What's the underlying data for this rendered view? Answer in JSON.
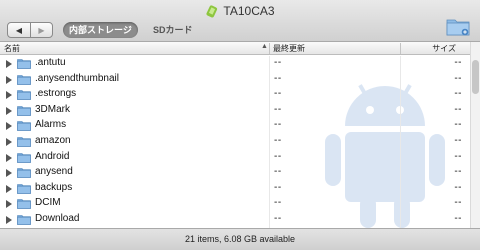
{
  "window": {
    "title": "TA10CA3",
    "nav": {
      "back_glyph": "◀",
      "forward_glyph": "▶"
    },
    "storage_tabs": [
      {
        "label": "内部ストレージ",
        "active": true
      },
      {
        "label": "SDカード",
        "active": false
      }
    ],
    "icons": {
      "title": "android-device-icon",
      "new_folder": "new-folder-icon",
      "watermark": "android-robot-watermark"
    }
  },
  "columns": {
    "name": "名前",
    "date": "最終更新",
    "size": "サイズ"
  },
  "files": [
    {
      "name": ".antutu",
      "date": "--",
      "size": "--"
    },
    {
      "name": ".anysendthumbnail",
      "date": "--",
      "size": "--"
    },
    {
      "name": ".estrongs",
      "date": "--",
      "size": "--"
    },
    {
      "name": "3DMark",
      "date": "--",
      "size": "--"
    },
    {
      "name": "Alarms",
      "date": "--",
      "size": "--"
    },
    {
      "name": "amazon",
      "date": "--",
      "size": "--"
    },
    {
      "name": "Android",
      "date": "--",
      "size": "--"
    },
    {
      "name": "anysend",
      "date": "--",
      "size": "--"
    },
    {
      "name": "backups",
      "date": "--",
      "size": "--"
    },
    {
      "name": "DCIM",
      "date": "--",
      "size": "--"
    },
    {
      "name": "Download",
      "date": "--",
      "size": "--"
    }
  ],
  "status": "21 items, 6.08 GB available",
  "colors": {
    "folder": "#7fb0e0",
    "watermark": "#8fb0dd",
    "active_tab": "#8c8c8c"
  }
}
